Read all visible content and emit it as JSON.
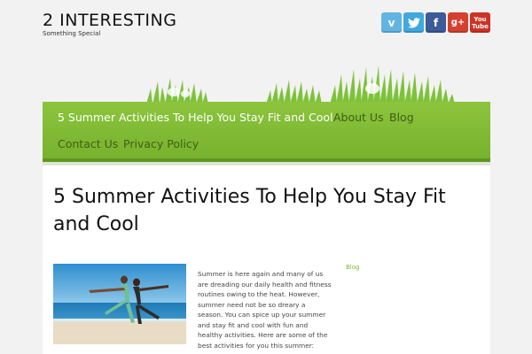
{
  "site": {
    "title": "2 INTERESTING",
    "tagline": "Something Special"
  },
  "social": [
    {
      "name": "vimeo",
      "glyph": "v",
      "color": "#62b4e3"
    },
    {
      "name": "twitter",
      "glyph": "t",
      "color": "#3fa9e0"
    },
    {
      "name": "facebook",
      "glyph": "f",
      "color": "#3b5b99"
    },
    {
      "name": "google-plus",
      "glyph": "g+",
      "color": "#d6402f"
    },
    {
      "name": "youtube",
      "glyph_line1": "You",
      "glyph_line2": "Tube",
      "color": "#cc3325"
    }
  ],
  "nav": {
    "items": [
      {
        "label": "5 Summer Activities To Help You Stay Fit and Cool",
        "active": true
      },
      {
        "label": "About Us"
      },
      {
        "label": "Blog"
      },
      {
        "label": "Contact Us"
      },
      {
        "label": "Privacy Policy"
      }
    ],
    "color": "#84bd36"
  },
  "post": {
    "title": "5 Summer Activities To Help You Stay Fit and Cool",
    "excerpt": "Summer is here again and many of us are dreading our daily health and fitness routines owing to the heat. However, summer need not be so dreary a season. You can spice up your summer and stay fit and cool with fun and healthy activities. Here are some of the best activities for you this summer:",
    "category": "Blog"
  }
}
